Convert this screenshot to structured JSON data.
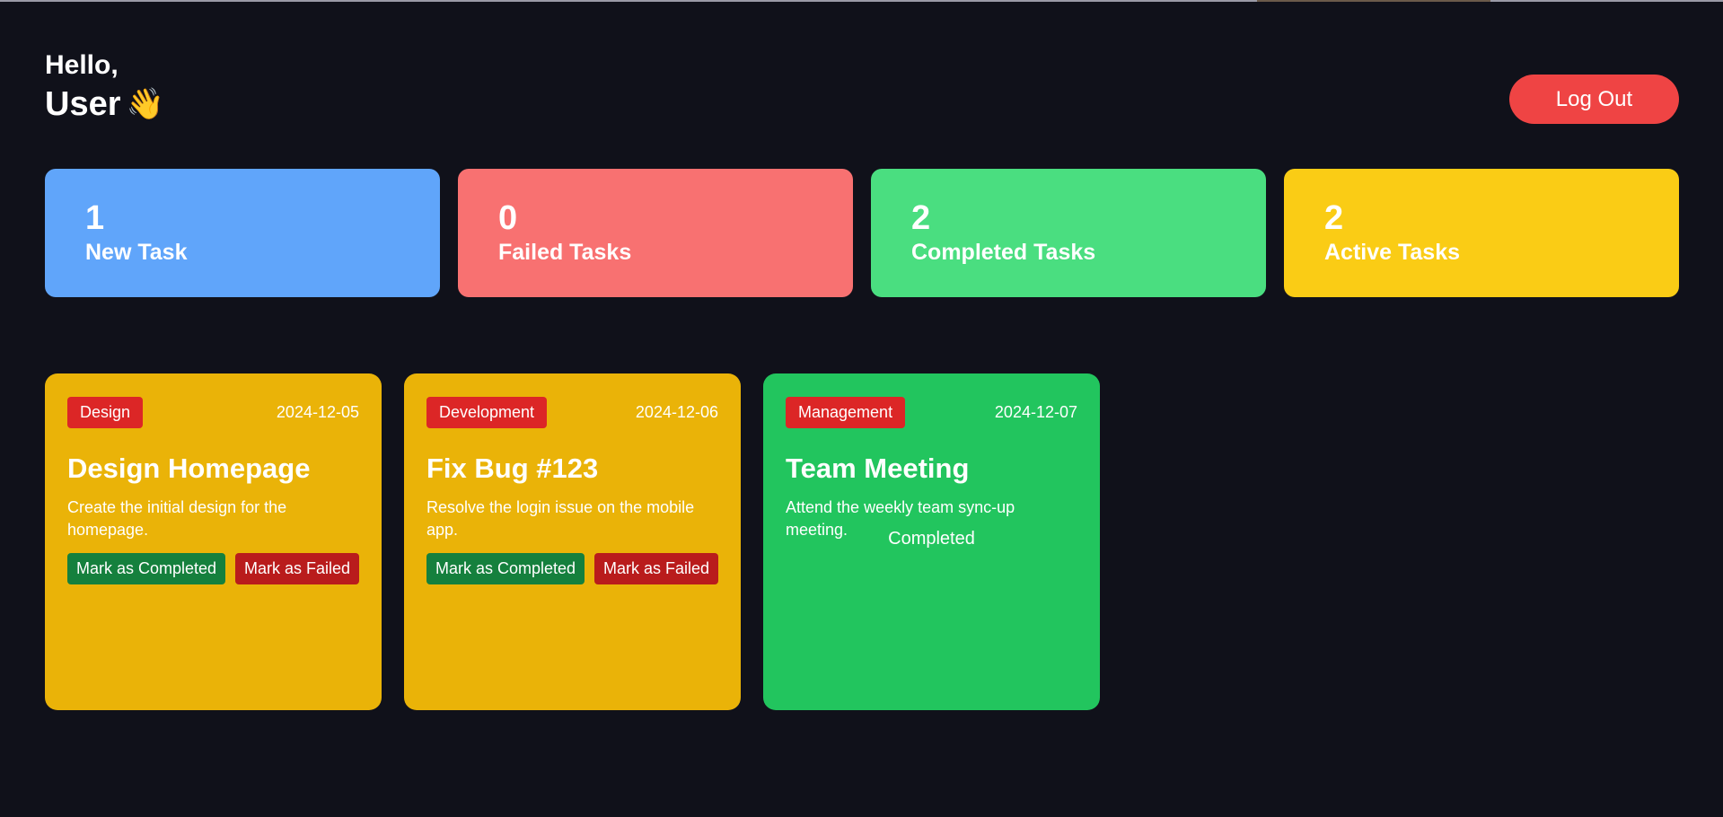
{
  "header": {
    "greeting": "Hello,",
    "username": "User",
    "wave_emoji": "👋",
    "logout_label": "Log Out"
  },
  "colors": {
    "background": "#10111a",
    "logout": "#ef4444",
    "new": "#60a5fa",
    "failed": "#f87171",
    "completed": "#4ade80",
    "active": "#facc15",
    "task_active_card": "#eab308",
    "task_completed_card": "#22c55e",
    "badge": "#dc2626",
    "complete_button": "#15803d",
    "fail_button": "#b91c1c"
  },
  "stats": [
    {
      "count": "1",
      "label": "New Task"
    },
    {
      "count": "0",
      "label": "Failed Tasks"
    },
    {
      "count": "2",
      "label": "Completed Tasks"
    },
    {
      "count": "2",
      "label": "Active Tasks"
    }
  ],
  "tasks": [
    {
      "category": "Design",
      "date": "2024-12-05",
      "title": "Design Homepage",
      "description": "Create the initial design for the homepage.",
      "complete_label": "Mark as Completed",
      "fail_label": "Mark as Failed"
    },
    {
      "category": "Development",
      "date": "2024-12-06",
      "title": "Fix Bug #123",
      "description": "Resolve the login issue on the mobile app.",
      "complete_label": "Mark as Completed",
      "fail_label": "Mark as Failed"
    },
    {
      "category": "Management",
      "date": "2024-12-07",
      "title": "Team Meeting",
      "description": "Attend the weekly team sync-up meeting.",
      "status": "Completed"
    }
  ]
}
